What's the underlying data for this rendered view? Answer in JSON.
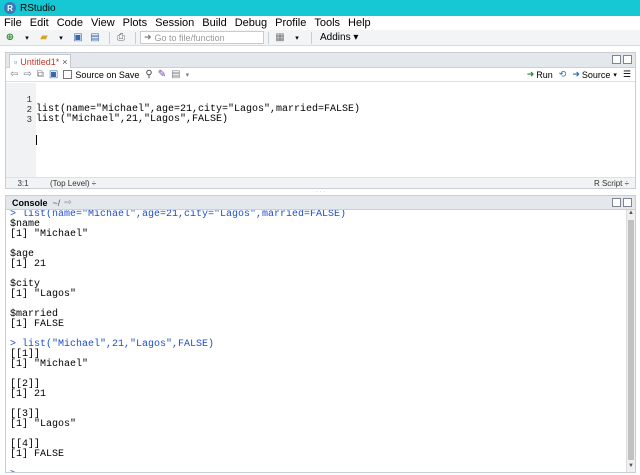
{
  "app": {
    "title": "RStudio",
    "icon_letter": "R"
  },
  "menu": [
    "File",
    "Edit",
    "Code",
    "View",
    "Plots",
    "Session",
    "Build",
    "Debug",
    "Profile",
    "Tools",
    "Help"
  ],
  "toolbar": {
    "goto_placeholder": "Go to file/function",
    "addins_label": "Addins"
  },
  "editor": {
    "tab_label": "Untitled1*",
    "source_on_save": "Source on Save",
    "run_label": "Run",
    "source_label": "Source",
    "lines": [
      {
        "n": "1",
        "text": "list(name=\"Michael\",age=21,city=\"Lagos\",married=FALSE)"
      },
      {
        "n": "2",
        "text": "list(\"Michael\",21,\"Lagos\",FALSE)"
      },
      {
        "n": "3",
        "text": ""
      }
    ],
    "status": {
      "position": "3:1",
      "scope": "(Top Level) ÷",
      "file_type": "R Script ÷"
    }
  },
  "console": {
    "title": "Console",
    "working_dir": "~/",
    "lines": [
      {
        "type": "in",
        "text": "> list(name=\"Michael\",age=21,city=\"Lagos\",married=FALSE)"
      },
      {
        "type": "out",
        "text": "$name"
      },
      {
        "type": "out",
        "text": "[1] \"Michael\""
      },
      {
        "type": "out",
        "text": ""
      },
      {
        "type": "out",
        "text": "$age"
      },
      {
        "type": "out",
        "text": "[1] 21"
      },
      {
        "type": "out",
        "text": ""
      },
      {
        "type": "out",
        "text": "$city"
      },
      {
        "type": "out",
        "text": "[1] \"Lagos\""
      },
      {
        "type": "out",
        "text": ""
      },
      {
        "type": "out",
        "text": "$married"
      },
      {
        "type": "out",
        "text": "[1] FALSE"
      },
      {
        "type": "out",
        "text": ""
      },
      {
        "type": "in",
        "text": "> list(\"Michael\",21,\"Lagos\",FALSE)"
      },
      {
        "type": "out",
        "text": "[[1]]"
      },
      {
        "type": "out",
        "text": "[1] \"Michael\""
      },
      {
        "type": "out",
        "text": ""
      },
      {
        "type": "out",
        "text": "[[2]]"
      },
      {
        "type": "out",
        "text": "[1] 21"
      },
      {
        "type": "out",
        "text": ""
      },
      {
        "type": "out",
        "text": "[[3]]"
      },
      {
        "type": "out",
        "text": "[1] \"Lagos\""
      },
      {
        "type": "out",
        "text": ""
      },
      {
        "type": "out",
        "text": "[[4]]"
      },
      {
        "type": "out",
        "text": "[1] FALSE"
      },
      {
        "type": "out",
        "text": ""
      },
      {
        "type": "in",
        "text": ">"
      }
    ]
  }
}
